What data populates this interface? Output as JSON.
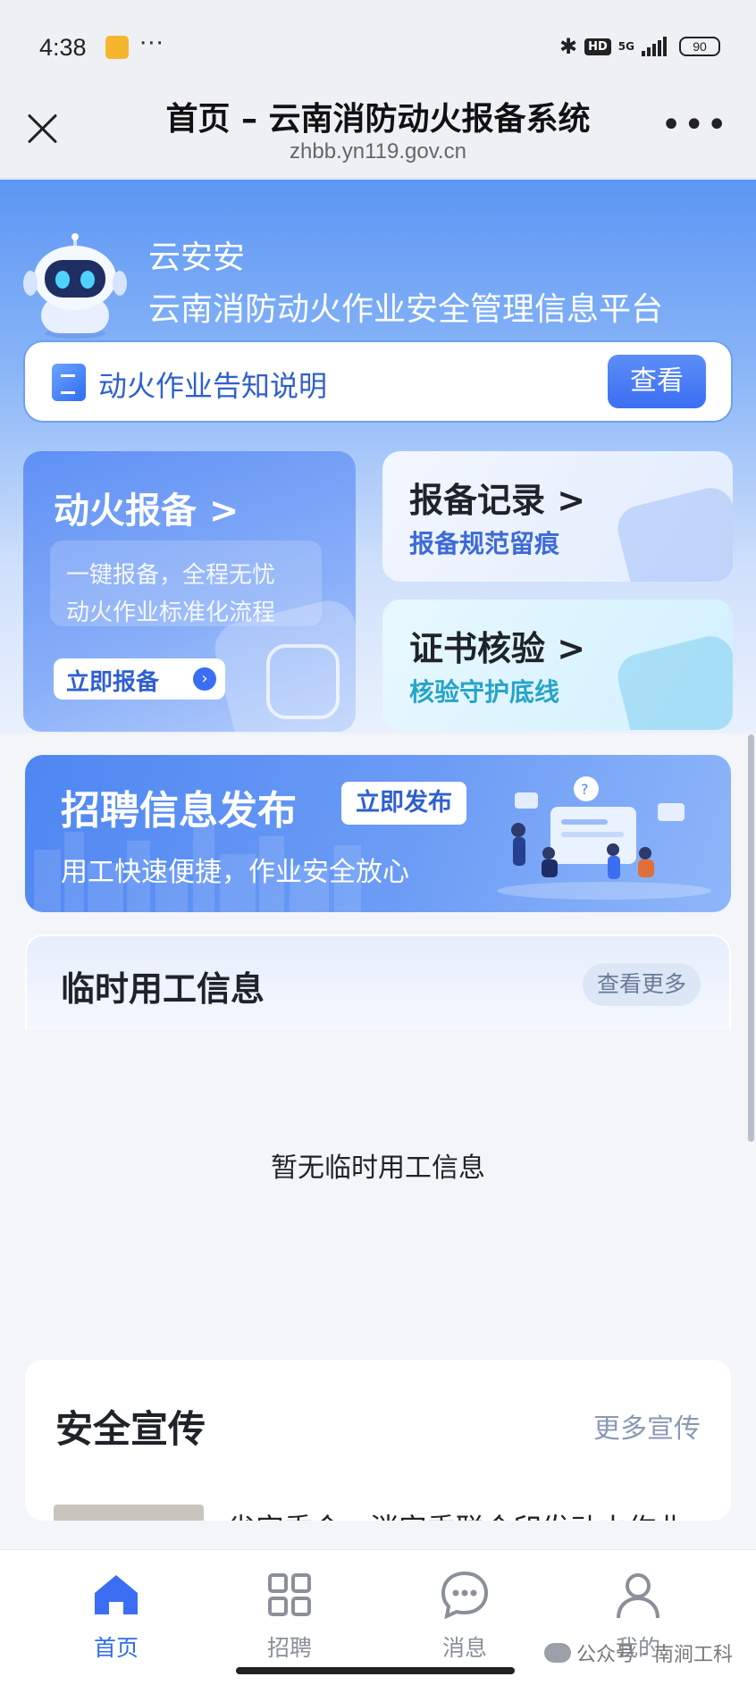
{
  "status_bar": {
    "time": "4:38",
    "more": "···",
    "hd": "HD",
    "network": "5G",
    "battery": "90"
  },
  "title_bar": {
    "title": "首页 – 云南消防动火报备系统",
    "url": "zhbb.yn119.gov.cn",
    "more": "•••"
  },
  "hero": {
    "name": "云安安",
    "subtitle": "云南消防动火作业安全管理信息平台",
    "notice": {
      "text": "动火作业告知说明",
      "button": "查看"
    },
    "report_card": {
      "title": "动火报备 >",
      "line1": "一键报备，全程无忧",
      "line2": "动火作业标准化流程",
      "button": "立即报备",
      "arrow": "›"
    },
    "records_card": {
      "title": "报备记录 >",
      "subtitle": "报备规范留痕"
    },
    "cert_card": {
      "title": "证书核验 >",
      "subtitle": "核验守护底线"
    }
  },
  "recruit_banner": {
    "title": "招聘信息发布",
    "button": "立即发布",
    "subtitle": "用工快速便捷，作业安全放心"
  },
  "temp_work": {
    "title": "临时用工信息",
    "more": "查看更多",
    "empty": "暂无临时用工信息"
  },
  "safety": {
    "title": "安全宣传",
    "more": "更多宣传",
    "news_title": "省安委会、消安委联合印发动火作业"
  },
  "tabs": [
    {
      "label": "首页",
      "icon": "home-icon",
      "active": true
    },
    {
      "label": "招聘",
      "icon": "grid-icon",
      "active": false
    },
    {
      "label": "消息",
      "icon": "chat-icon",
      "active": false
    },
    {
      "label": "我的",
      "icon": "user-icon",
      "active": false
    }
  ],
  "watermark": "公众号 · 南涧工科",
  "colors": {
    "primary": "#3b6ef2",
    "hero_top": "#5c96f4",
    "cert_accent": "#26a4c9",
    "text": "#1f2329"
  }
}
